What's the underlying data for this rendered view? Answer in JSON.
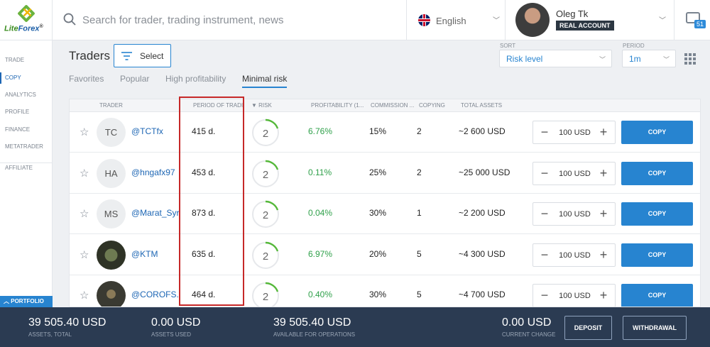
{
  "app": {
    "logo_text_a": "Lite",
    "logo_text_b": "Forex",
    "logo_mark": "®"
  },
  "search": {
    "placeholder": "Search for trader, trading instrument, news"
  },
  "language": {
    "label": "English"
  },
  "user": {
    "name": "Oleg Tk",
    "account_type": "REAL ACCOUNT"
  },
  "messages": {
    "count": "51"
  },
  "sidebar": {
    "items": [
      {
        "label": "TRADE"
      },
      {
        "label": "COPY"
      },
      {
        "label": "ANALYTICS"
      },
      {
        "label": "PROFILE"
      },
      {
        "label": "FINANCE"
      },
      {
        "label": "METATRADER"
      },
      {
        "label": "AFFILIATE"
      }
    ],
    "portfolio": "PORTFOLIO"
  },
  "page": {
    "title": "Traders",
    "select_label": "Select"
  },
  "tabs": [
    {
      "label": "Favorites"
    },
    {
      "label": "Popular"
    },
    {
      "label": "High profitability"
    },
    {
      "label": "Minimal risk"
    }
  ],
  "sort": {
    "label": "SORT",
    "value": "Risk level"
  },
  "period": {
    "label": "PERIOD",
    "value": "1m"
  },
  "table": {
    "headers": {
      "trader": "TRADER",
      "period": "PERIOD OF TRADI...",
      "risk": "▼ RISK",
      "profitability": "PROFITABILITY (1...",
      "commission": "COMMISSION ...",
      "copying": "COPYING",
      "total_assets": "TOTAL ASSETS"
    },
    "rows": [
      {
        "initials": "TC",
        "handle": "@TCTfx",
        "period": "415 d.",
        "risk": "2",
        "profitability": "6.76%",
        "commission": "15%",
        "copying": "2",
        "assets": "~2 600 USD",
        "amount": "100 USD",
        "copy": "COPY"
      },
      {
        "initials": "HA",
        "handle": "@hngafx97",
        "period": "453 d.",
        "risk": "2",
        "profitability": "0.11%",
        "commission": "25%",
        "copying": "2",
        "assets": "~25 000 USD",
        "amount": "100 USD",
        "copy": "COPY"
      },
      {
        "initials": "MS",
        "handle": "@Marat_Syr",
        "period": "873 d.",
        "risk": "2",
        "profitability": "0.04%",
        "commission": "30%",
        "copying": "1",
        "assets": "~2 200 USD",
        "amount": "100 USD",
        "copy": "COPY"
      },
      {
        "initials": "",
        "handle": "@KTM",
        "period": "635 d.",
        "risk": "2",
        "profitability": "6.97%",
        "commission": "20%",
        "copying": "5",
        "assets": "~4 300 USD",
        "amount": "100 USD",
        "copy": "COPY"
      },
      {
        "initials": "",
        "handle": "@COROFS...",
        "period": "464 d.",
        "risk": "2",
        "profitability": "0.40%",
        "commission": "30%",
        "copying": "5",
        "assets": "~4 700 USD",
        "amount": "100 USD",
        "copy": "COPY"
      }
    ]
  },
  "footer": {
    "assets_total": {
      "value": "39 505.40 USD",
      "label": "ASSETS, TOTAL"
    },
    "assets_used": {
      "value": "0.00 USD",
      "label": "ASSETS USED"
    },
    "available": {
      "value": "39 505.40 USD",
      "label": "AVAILABLE FOR OPERATIONS"
    },
    "current_change": {
      "value": "0.00 USD",
      "label": "CURRENT CHANGE"
    },
    "deposit": "DEPOSIT",
    "withdrawal": "WITHDRAWAL"
  },
  "colors": {
    "accent": "#2784d0",
    "positive": "#2fa04a",
    "footer_bg": "#2b3b52",
    "highlight": "#c62828"
  }
}
